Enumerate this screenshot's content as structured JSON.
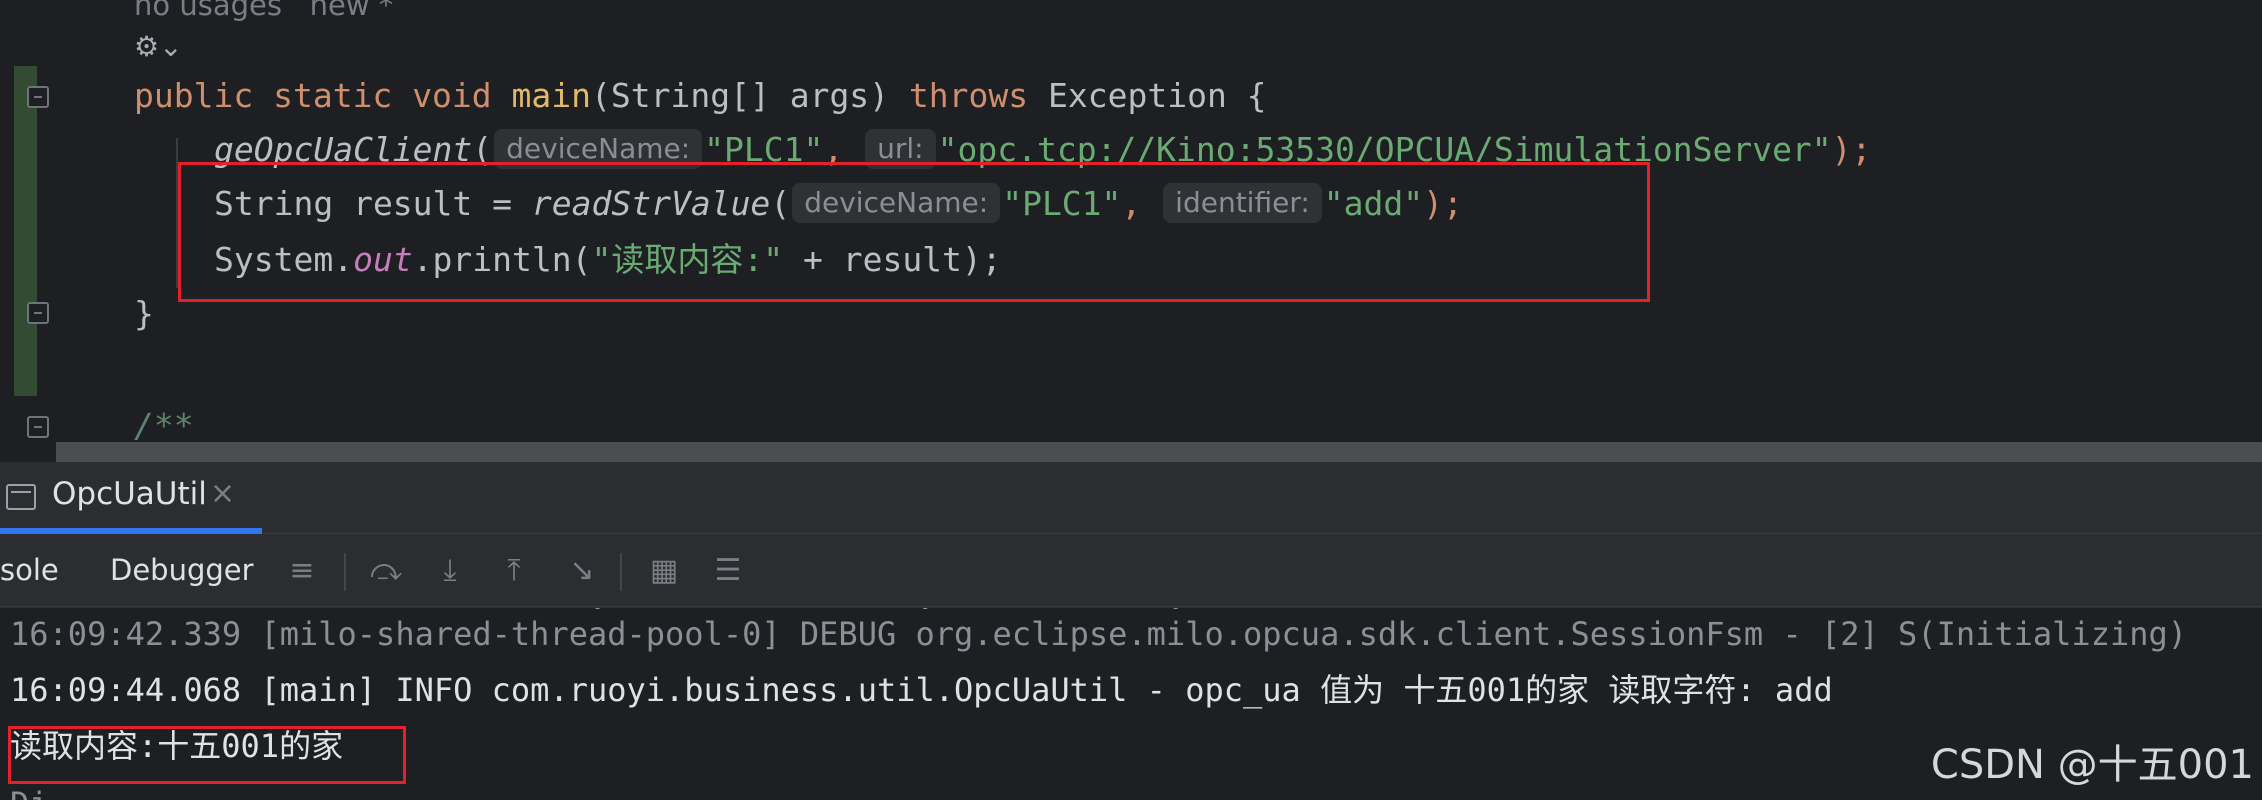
{
  "editor": {
    "usages_text": "no usages   new *",
    "line_main": {
      "kw_public": "public",
      "kw_static": "static",
      "kw_void": "void",
      "method": "main",
      "params": "(String[] args) ",
      "kw_throws": "throws",
      "tail": " Exception {"
    },
    "line_client": {
      "call": "geOpcUaClient",
      "open": "(",
      "hint_device": "deviceName:",
      "device": "\"PLC1\"",
      "comma": ", ",
      "hint_url": "url:",
      "url": "\"opc.tcp://Kino:53530/OPCUA/SimulationServer\"",
      "close": ");"
    },
    "line_read": {
      "decl": "String result = ",
      "call": "readStrValue",
      "open": "(",
      "hint_device": "deviceName:",
      "device": "\"PLC1\"",
      "comma": ", ",
      "hint_identifier": "identifier:",
      "identifier": "\"add\"",
      "close": ");"
    },
    "line_print": {
      "system": "System.",
      "out": "out",
      "println": ".println(",
      "string": "\"读取内容:\"",
      "rest": " + result);"
    },
    "line_close": "}",
    "line_comment": "/**"
  },
  "toolwindow": {
    "run_tab_label": "OpcUaUtil",
    "close_glyph": "×",
    "console_tab": "sole",
    "debugger_tab": "Debugger"
  },
  "console": {
    "line_top_partial": "                              .                .            .",
    "line1": "16:09:42.339 [milo-shared-thread-pool-0] DEBUG org.eclipse.milo.opcua.sdk.client.SessionFsm - [2] S(Initializing)",
    "line2": "16:09:44.068 [main] INFO com.ruoyi.business.util.OpcUaUtil - opc_ua 值为 十五001的家 读取字符: add",
    "line3": "读取内容:十五001的家"
  },
  "watermark": "CSDN @十五001"
}
